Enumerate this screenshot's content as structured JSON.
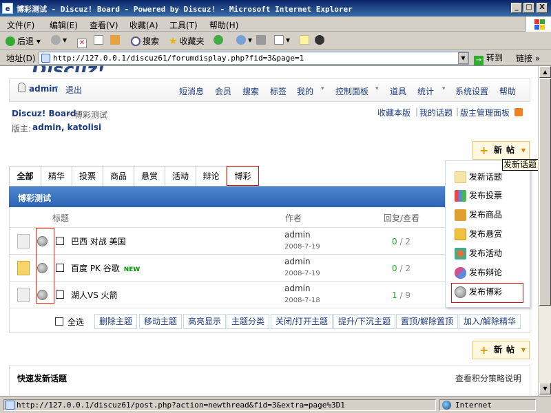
{
  "window": {
    "title": "博彩测试 - Discuz! Board - Powered by Discuz! - Microsoft Internet Explorer",
    "minimize": "_",
    "maximize": "□",
    "close": "X"
  },
  "menubar": [
    "文件(F)",
    "编辑(E)",
    "查看(V)",
    "收藏(A)",
    "工具(T)",
    "帮助(H)"
  ],
  "toolbar": {
    "back": "后退",
    "search": "搜索",
    "favorites": "收藏夹"
  },
  "address": {
    "label": "地址(D)",
    "url": "http://127.0.0.1/discuz61/forumdisplay.php?fid=3&page=1",
    "go": "转到",
    "links": "链接"
  },
  "userbar": {
    "username": "admin",
    "logout": "退出",
    "nav": [
      "短消息",
      "会员",
      "搜索",
      "标签",
      "我的",
      "控制面板",
      "道具",
      "统计",
      "系统设置",
      "帮助"
    ]
  },
  "breadcrumb": {
    "home": "Discuz! Board",
    "sep": "»",
    "current": "博彩测试",
    "links": [
      "收藏本版",
      "我的话题",
      "版主管理面板"
    ],
    "moderators_label": "版主:",
    "moderators": "admin, katolisi"
  },
  "new_post_button": "新帖",
  "tooltip": "发新话题",
  "tabs": [
    "全部",
    "精华",
    "投票",
    "商品",
    "悬赏",
    "活动",
    "辩论",
    "博彩"
  ],
  "forum_title": "博彩测试",
  "columns": {
    "title": "标题",
    "author": "作者",
    "replies": "回复/查看"
  },
  "threads": [
    {
      "title": "巴西 对战 美国",
      "badge": "",
      "author": "admin",
      "date": "2008-7-19",
      "replies": "0",
      "views": "2",
      "hot": false
    },
    {
      "title": "百度 PK 谷歌",
      "badge": "NEW",
      "author": "admin",
      "date": "2008-7-19",
      "replies": "0",
      "views": "2",
      "hot": true
    },
    {
      "title": "湖人VS 火箭",
      "badge": "",
      "author": "admin",
      "date": "2008-7-18",
      "replies": "1",
      "views": "9",
      "hot": false
    }
  ],
  "select_all": "全选",
  "actions": [
    "删除主题",
    "移动主题",
    "高亮显示",
    "主题分类",
    "关闭/打开主题",
    "提升/下沉主题",
    "置顶/解除置顶",
    "加入/解除精华"
  ],
  "new_post_menu": [
    {
      "label": "发新话题",
      "icon": "doc-icon",
      "color": "#f5e6a8"
    },
    {
      "label": "发布投票",
      "icon": "poll-icon",
      "color": "#5a8ad8"
    },
    {
      "label": "发布商品",
      "icon": "goods-icon",
      "color": "#e0a030"
    },
    {
      "label": "发布悬赏",
      "icon": "reward-icon",
      "color": "#f0c040"
    },
    {
      "label": "发布活动",
      "icon": "activity-icon",
      "color": "#e07040"
    },
    {
      "label": "发布辩论",
      "icon": "debate-icon",
      "color": "#d05090"
    },
    {
      "label": "发布博彩",
      "icon": "globe-icon",
      "color": "#999999"
    }
  ],
  "quick_post": {
    "title": "快速发新话题",
    "help": "查看积分策略说明"
  },
  "status": {
    "url": "http://127.0.0.1/discuz61/post.php?action=newthread&fid=3&extra=page%3D1",
    "zone": "Internet"
  },
  "colors": {
    "highlight_border": "#e21111",
    "header_blue": "#2d63b1",
    "link": "#1a3a80"
  }
}
